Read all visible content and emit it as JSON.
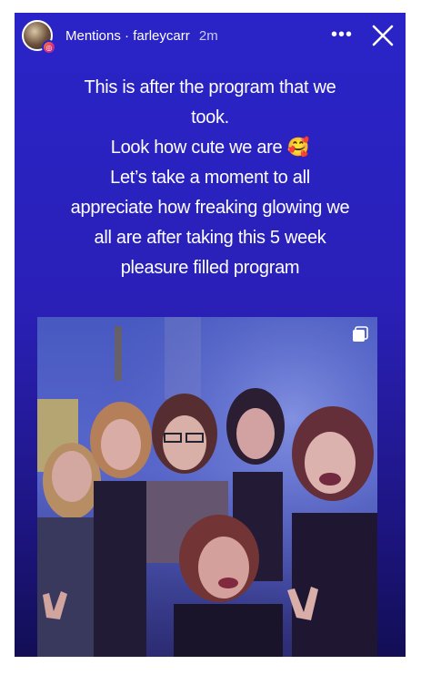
{
  "header": {
    "label": "Mentions",
    "separator": "·",
    "username": "farleycarr",
    "time": "2m",
    "more_icon": "more-horizontal-icon",
    "close_icon": "close-icon"
  },
  "caption": {
    "lines": [
      "This is after the program that we",
      "took.",
      "Look how cute we are 🥰",
      "Let’s take a moment to all",
      "appreciate how freaking glowing we",
      "all are after taking this 5 week",
      "pleasure filled program"
    ]
  },
  "photo": {
    "description_icon": "multiple-photos-icon"
  },
  "colors": {
    "story_top": "#2a24c8",
    "story_bottom": "#130e55",
    "text": "#ffffff"
  }
}
